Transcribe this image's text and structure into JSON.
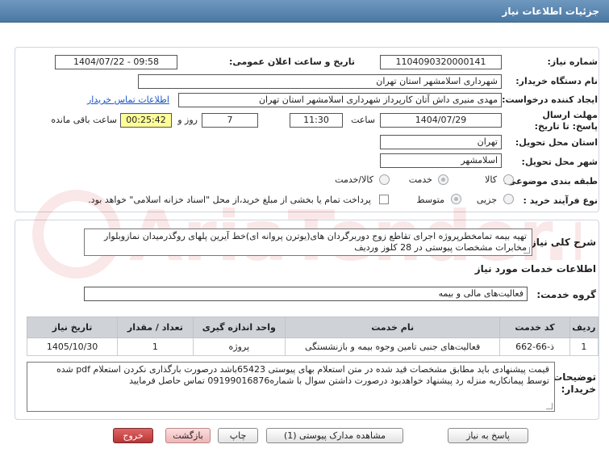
{
  "header": {
    "title": "جزئیات اطلاعات نیاز"
  },
  "fields": {
    "need_number_label": "شماره نیاز:",
    "need_number": "1104090320000141",
    "announce_label": "تاریخ و ساعت اعلان عمومی:",
    "announce_value": "1404/07/22 - 09:58",
    "buyer_label": "نام دستگاه خریدار:",
    "buyer_value": "شهرداری اسلامشهر استان تهران",
    "creator_label": "ایجاد کننده درخواست:",
    "creator_value": "مهدی منیری داش آتان کارپرداز شهرداری اسلامشهر استان تهران",
    "contact_link": "اطلاعات تماس خریدار",
    "deadline_label": "مهلت ارسال پاسخ: تا تاریخ:",
    "deadline_date": "1404/07/29",
    "time_label": "ساعت",
    "deadline_time": "11:30",
    "days_value": "7",
    "days_label": "روز و",
    "remaining_value": "00:25:42",
    "remaining_label": "ساعت باقی مانده",
    "province_label": "استان محل تحویل:",
    "province_value": "تهران",
    "city_label": "شهر محل تحویل:",
    "city_value": "اسلامشهر",
    "category_label": "طبقه بندی موضوعی:",
    "category_options": [
      "کالا",
      "خدمت",
      "کالا/خدمت"
    ],
    "process_label": "نوع فرآیند خرید :",
    "process_options": [
      "جزیی",
      "متوسط"
    ],
    "payment_note": "پرداخت تمام یا بخشی از مبلغ خرید،از محل \"اسناد خزانه اسلامی\" خواهد بود."
  },
  "description": {
    "summary_label": "شرح کلی نیاز:",
    "summary_text": "تهیه بیمه تمامخطرپروژه اجرای تقاطع زوج دوربرگردان های(یوترن پروانه ای)خط آیرین پلهای روگذرمیدان نمازوبلوار مخابرات مشخصات پیوستی در 28 کلوز وردیف",
    "services_heading": "اطلاعات خدمات مورد نیاز",
    "service_group_label": "گروه خدمت:",
    "service_group_value": "فعالیت‌های مالی و بیمه",
    "table": {
      "headers": [
        "ردیف",
        "کد خدمت",
        "نام خدمت",
        "واحد اندازه گیری",
        "تعداد / مقدار",
        "تاریخ نیاز"
      ],
      "rows": [
        [
          "1",
          "ذ-66-662",
          "فعالیت‌های جنبی تامین وجوه بیمه و بازنشستگی",
          "پروژه",
          "1",
          "1405/10/30"
        ]
      ]
    },
    "buyer_notes_label": "توضیحات خریدار:",
    "buyer_notes_text": "قیمت پیشنهادی باید مطابق مشخصات قید شده در متن استعلام بهای پیوستی 65423باشد درصورت بارگذاری نکردن استعلام pdf شده توسط پیمانکاربه منزله رد پیشنهاد خواهدبود  درصورت داشتن سوال با شماره09199016876 تماس حاصل فرمایید"
  },
  "buttons": {
    "reply": "پاسخ به نیاز",
    "attachments": "مشاهده مدارک پیوستی (1)",
    "print": "چاپ",
    "back": "بازگشت",
    "exit": "خروج"
  },
  "watermark": {
    "text": "AriaTender.net"
  },
  "colors": {
    "header": "#4a78a3",
    "link": "#1a56c7",
    "highlight": "#ffff99",
    "exit": "#b33333"
  }
}
